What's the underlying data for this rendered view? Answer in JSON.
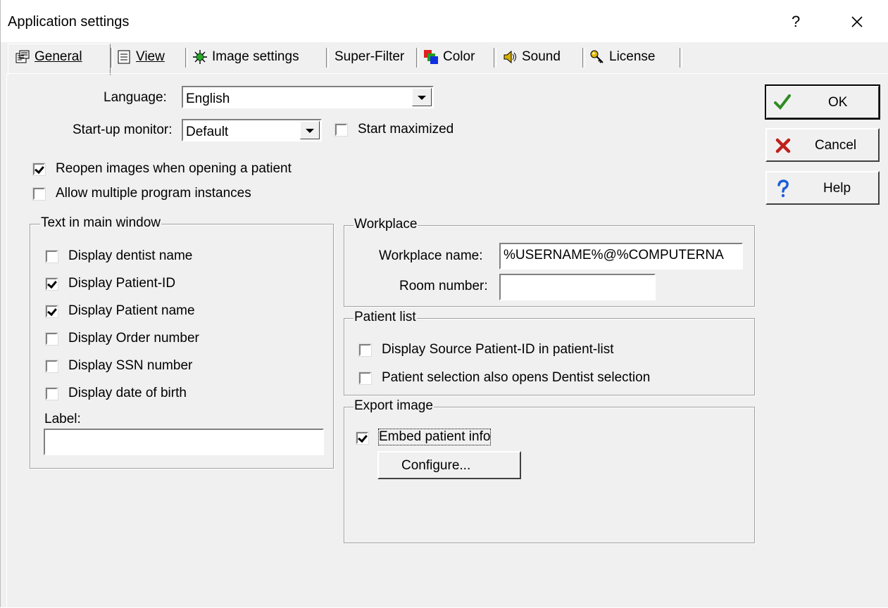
{
  "window": {
    "title": "Application settings",
    "help_glyph": "?",
    "close_icon": "close-icon"
  },
  "tabs": [
    {
      "label": "General",
      "icon": "general-settings-icon",
      "active": true
    },
    {
      "label": "View",
      "icon": "view-document-icon"
    },
    {
      "label": "Image settings",
      "icon": "bug-image-icon"
    },
    {
      "label": "Super-Filter"
    },
    {
      "label": "Color",
      "icon": "color-squares-icon"
    },
    {
      "label": "Sound",
      "icon": "speaker-icon"
    },
    {
      "label": "License",
      "icon": "key-icon"
    }
  ],
  "general": {
    "language_label": "Language:",
    "language_value": "English",
    "startup_label": "Start-up monitor:",
    "startup_value": "Default",
    "start_maximized": {
      "label": "Start maximized",
      "checked": false
    },
    "reopen_images": {
      "label": "Reopen images when opening a patient",
      "checked": true
    },
    "allow_multiple": {
      "label": "Allow multiple program instances",
      "checked": false
    }
  },
  "text_main_window": {
    "title": "Text in main window",
    "options": [
      {
        "label": "Display dentist name",
        "checked": false
      },
      {
        "label": "Display Patient-ID",
        "checked": true
      },
      {
        "label": "Display Patient name",
        "checked": true
      },
      {
        "label": "Display Order number",
        "checked": false
      },
      {
        "label": "Display SSN number",
        "checked": false
      },
      {
        "label": "Display date of birth",
        "checked": false
      }
    ],
    "label_caption": "Label:",
    "label_value": ""
  },
  "workplace": {
    "title": "Workplace",
    "name_label": "Workplace name:",
    "name_value": "%USERNAME%@%COMPUTERNA",
    "room_label": "Room number:",
    "room_value": ""
  },
  "patient_list": {
    "title": "Patient list",
    "options": [
      {
        "label": "Display Source Patient-ID in patient-list",
        "checked": false
      },
      {
        "label": "Patient selection also opens Dentist selection",
        "checked": false
      }
    ]
  },
  "export_image": {
    "title": "Export image",
    "embed": {
      "label": "Embed patient info",
      "checked": true
    },
    "configure_label": "Configure..."
  },
  "buttons": {
    "ok": "OK",
    "cancel": "Cancel",
    "help": "Help"
  },
  "colors": {
    "ok_check": "#2e8b22",
    "cancel_x": "#c0201a",
    "help_q": "#1c5fd6"
  }
}
